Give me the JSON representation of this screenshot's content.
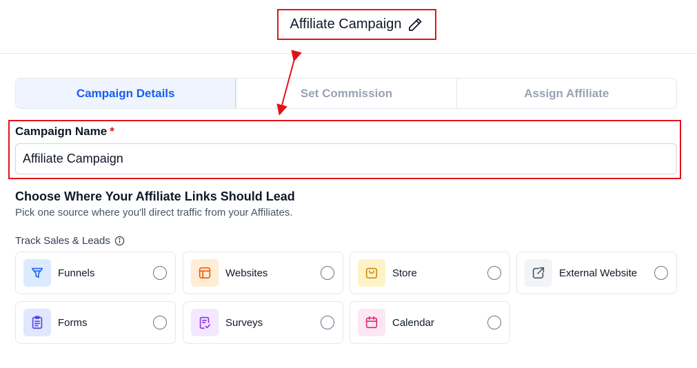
{
  "header": {
    "title": "Affiliate Campaign"
  },
  "steps": [
    {
      "label": "Campaign Details",
      "active": true
    },
    {
      "label": "Set Commission",
      "active": false
    },
    {
      "label": "Assign Affiliate",
      "active": false
    }
  ],
  "campaign_name": {
    "label": "Campaign Name",
    "required_mark": "*",
    "value": "Affiliate Campaign"
  },
  "destination": {
    "title": "Choose Where Your Affiliate Links Should Lead",
    "subtitle": "Pick one source where you'll direct traffic from your Affiliates.",
    "track_label": "Track Sales & Leads"
  },
  "sources": [
    {
      "label": "Funnels",
      "icon": "funnel-icon",
      "bg": "#dbeafe",
      "color": "#2563eb"
    },
    {
      "label": "Websites",
      "icon": "layout-icon",
      "bg": "#ffedd5",
      "color": "#ea580c"
    },
    {
      "label": "Store",
      "icon": "shopping-bag-icon",
      "bg": "#fef3c7",
      "color": "#ca8a04"
    },
    {
      "label": "External Website",
      "icon": "external-link-icon",
      "bg": "#f2f4f7",
      "color": "#475467"
    },
    {
      "label": "Forms",
      "icon": "clipboard-icon",
      "bg": "#e0e7ff",
      "color": "#4f46e5"
    },
    {
      "label": "Surveys",
      "icon": "survey-icon",
      "bg": "#f3e8ff",
      "color": "#9333ea"
    },
    {
      "label": "Calendar",
      "icon": "calendar-icon",
      "bg": "#fce7f3",
      "color": "#db2777"
    }
  ],
  "colors": {
    "accent": "#155eef",
    "annotation": "#e0131b"
  }
}
